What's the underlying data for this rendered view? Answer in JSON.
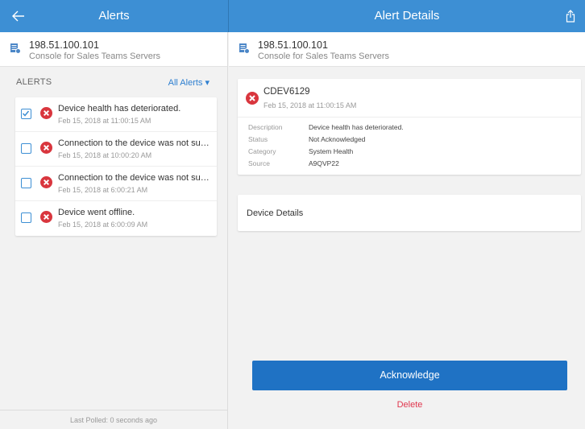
{
  "topbar": {
    "left_title": "Alerts",
    "right_title": "Alert Details",
    "accent_color": "#3d8fd4",
    "back_icon": "arrow-left-icon",
    "share_icon": "share-icon"
  },
  "device": {
    "ip": "198.51.100.101",
    "name": "Console for Sales Teams Servers",
    "icon": "server-icon"
  },
  "alerts_panel": {
    "section_label": "ALERTS",
    "filter_label": "All Alerts ▾",
    "items": [
      {
        "message": "Device health has deteriorated.",
        "time": "Feb 15, 2018 at 11:00:15 AM",
        "checked": true
      },
      {
        "message": "Connection to the device was not succ...",
        "time": "Feb 15, 2018 at 10:00:20 AM",
        "checked": false
      },
      {
        "message": "Connection to the device was not succ...",
        "time": "Feb 15, 2018 at 6:00:21 AM",
        "checked": false
      },
      {
        "message": "Device went offline.",
        "time": "Feb 15, 2018 at 6:00:09 AM",
        "checked": false
      }
    ],
    "footer": "Last Polled: 0 seconds ago"
  },
  "detail": {
    "id": "CDEV6129",
    "time": "Feb 15, 2018 at 11:00:15 AM",
    "fields": [
      {
        "key": "Description",
        "value": "Device health has deteriorated."
      },
      {
        "key": "Status",
        "value": "Not Acknowledged"
      },
      {
        "key": "Category",
        "value": "System Health"
      },
      {
        "key": "Source",
        "value": "A9QVP22"
      }
    ],
    "device_details_label": "Device Details",
    "acknowledge_label": "Acknowledge",
    "delete_label": "Delete",
    "error_color": "#d9363e",
    "button_color": "#1f72c4",
    "delete_color": "#e0364e"
  }
}
